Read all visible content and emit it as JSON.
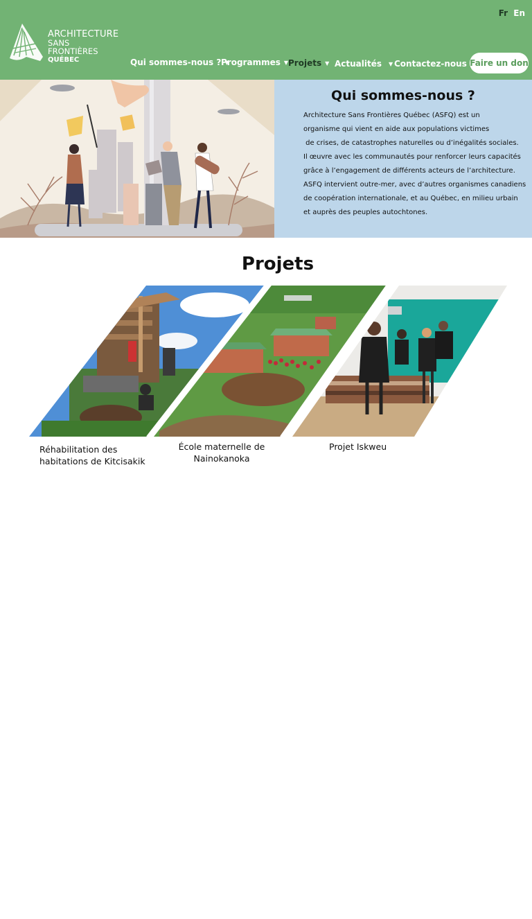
{
  "header": {
    "logo": {
      "line1": "ARCHITECTURE",
      "line2": "SANS FRONTIÈRES",
      "line3": "QUÉBEC"
    },
    "languages": [
      "Fr",
      "En"
    ],
    "nav": [
      {
        "label": "Qui sommes-nous ?",
        "has_dropdown": true,
        "active": false
      },
      {
        "label": "Programmes",
        "has_dropdown": true,
        "active": false
      },
      {
        "label": "Projets",
        "has_dropdown": true,
        "active": true
      },
      {
        "label": "Actualités",
        "has_dropdown": true,
        "active": false
      },
      {
        "label": "Contactez-nous",
        "has_dropdown": true,
        "active": false
      }
    ],
    "donate_label": "Faire un don"
  },
  "hero": {
    "title": "Qui sommes-nous ?",
    "lines": [
      "Architecture Sans Frontières Québec (ASFQ) est un",
      "organisme qui vient en aide aux populations victimes",
      " de crises, de catastrophes naturelles ou d’inégalités sociales.",
      "Il œuvre avec les communautés pour renforcer leurs capacités",
      "grâce à l’engagement de différents acteurs de l’architecture.",
      "ASFQ intervient outre-mer, avec d’autres organismes canadiens",
      "de coopération internationale, et au Québec, en milieu urbain",
      "et auprès des peuples autochtones."
    ]
  },
  "projects": {
    "title": "Projets",
    "items": [
      {
        "label_lines": [
          "Réhabilitation des",
          "habitations de Kitcisakik"
        ]
      },
      {
        "label_lines": [
          "École maternelle de",
          "Nainokanoka"
        ]
      },
      {
        "label_lines": [
          "Projet Iskweu"
        ]
      }
    ]
  },
  "colors": {
    "header_green": "#72b374",
    "hero_blue": "#bdd6ea",
    "accent_green": "#5a9d5c"
  }
}
